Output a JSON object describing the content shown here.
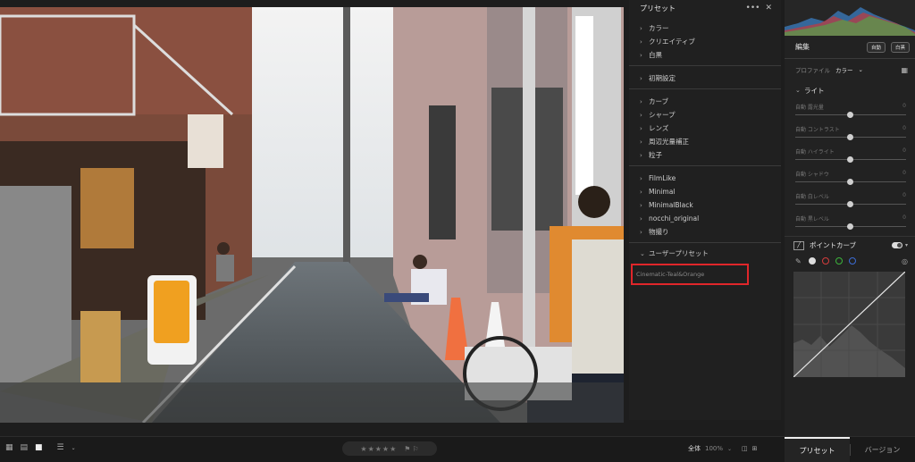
{
  "presets_panel": {
    "title": "プリセット",
    "menu_glyph": "•••",
    "close_glyph": "✕",
    "sections": [
      {
        "items": [
          "カラー",
          "クリエイティブ",
          "白黒"
        ]
      },
      {
        "items": [
          "初期設定"
        ]
      },
      {
        "items": [
          "カーブ",
          "シャープ",
          "レンズ",
          "周辺光量補正",
          "粒子"
        ]
      },
      {
        "items": [
          "FilmLike",
          "Minimal",
          "MinimalBlack",
          "nocchi_original",
          "物撮り"
        ]
      }
    ],
    "user_presets": {
      "label": "ユーザープリセット",
      "items": [
        "Cinematic-Teal&Orange"
      ]
    },
    "highlight_color": "#e0262a"
  },
  "edit_panel": {
    "title": "編集",
    "auto_label": "自動",
    "bw_label": "白黒",
    "profile_label": "プロファイル",
    "profile_value": "カラー",
    "light_label": "ライト",
    "sliders": [
      {
        "label": "自動 露光量",
        "value": "0"
      },
      {
        "label": "自動 コントラスト",
        "value": "0"
      },
      {
        "label": "自動 ハイライト",
        "value": "0"
      },
      {
        "label": "自動 シャドウ",
        "value": "0"
      },
      {
        "label": "自動 白レベル",
        "value": "0"
      },
      {
        "label": "自動 黒レベル",
        "value": "0"
      }
    ],
    "point_curve_label": "ポイントカーブ",
    "channel_colors": [
      "#dddddd",
      "#d43c3c",
      "#3cb43c",
      "#3c6cd4"
    ]
  },
  "bottom_bar": {
    "stars": "★★★★★",
    "fit_label": "全体",
    "zoom_value": "100%",
    "preset_tab": "プリセット",
    "version_tab": "バージョン"
  }
}
